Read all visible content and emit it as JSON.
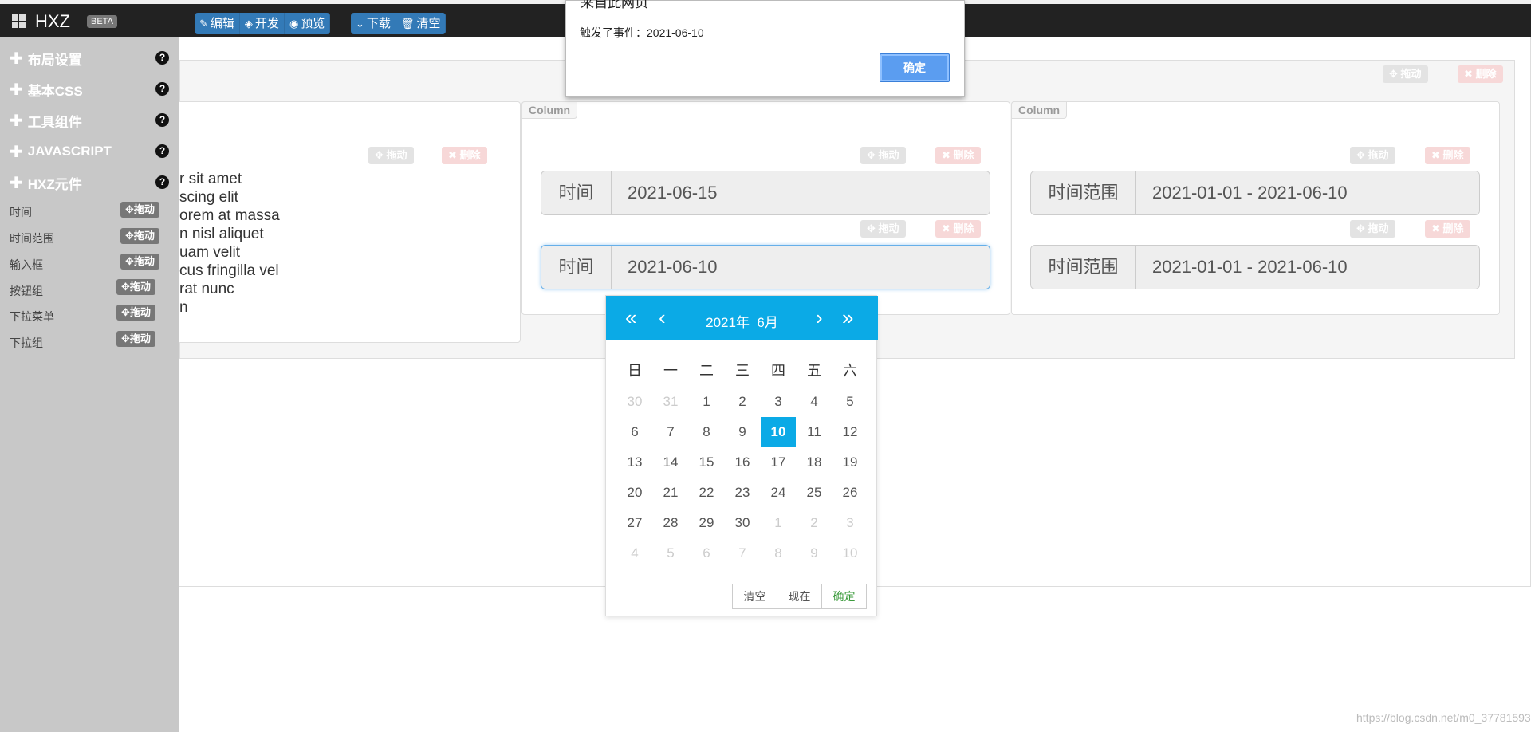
{
  "brand": {
    "name": "HXZ",
    "badge": "BETA"
  },
  "toolbar": {
    "edit": "编辑",
    "develop": "开发",
    "preview": "预览",
    "download": "下载",
    "clear": "清空"
  },
  "sidebar": {
    "sections": [
      "布局设置",
      "基本CSS",
      "工具组件",
      "JAVASCRIPT",
      "HXZ元件"
    ],
    "help_glyph": "?",
    "components": [
      {
        "label": "时间",
        "action": "拖动"
      },
      {
        "label": "时间范围",
        "action": "拖动"
      },
      {
        "label": "输入框",
        "action": "拖动"
      },
      {
        "label": "按钮组",
        "action": "拖动"
      },
      {
        "label": "下拉菜单",
        "action": "拖动"
      },
      {
        "label": "下拉组",
        "action": "拖动"
      }
    ]
  },
  "canvas": {
    "drag": "拖动",
    "delete": "删除",
    "column_label": "Column",
    "lorem_lines": [
      "r sit amet",
      "scing elit",
      "orem at massa",
      "n nisl aliquet",
      "uam velit",
      "cus fringilla vel",
      "rat nunc",
      "n"
    ],
    "time_label": "时间",
    "time_values": [
      "2021-06-15",
      "2021-06-10"
    ],
    "range_label": "时间范围",
    "range_values": [
      "2021-01-01 - 2021-06-10",
      "2021-01-01 - 2021-06-10"
    ]
  },
  "alert": {
    "title": "来自此网页",
    "message": "触发了事件：2021-06-10",
    "ok": "确定"
  },
  "datepicker": {
    "year": "2021年",
    "month": "6月",
    "weekdays": [
      "日",
      "一",
      "二",
      "三",
      "四",
      "五",
      "六"
    ],
    "days": [
      [
        "30",
        "31",
        "1",
        "2",
        "3",
        "4",
        "5"
      ],
      [
        "6",
        "7",
        "8",
        "9",
        "10",
        "11",
        "12"
      ],
      [
        "13",
        "14",
        "15",
        "16",
        "17",
        "18",
        "19"
      ],
      [
        "20",
        "21",
        "22",
        "23",
        "24",
        "25",
        "26"
      ],
      [
        "27",
        "28",
        "29",
        "30",
        "1",
        "2",
        "3"
      ],
      [
        "4",
        "5",
        "6",
        "7",
        "8",
        "9",
        "10"
      ]
    ],
    "selected": "10",
    "clear": "清空",
    "now": "现在",
    "confirm": "确定",
    "accent": "#0baae6"
  },
  "watermark": "https://blog.csdn.net/m0_37781593"
}
